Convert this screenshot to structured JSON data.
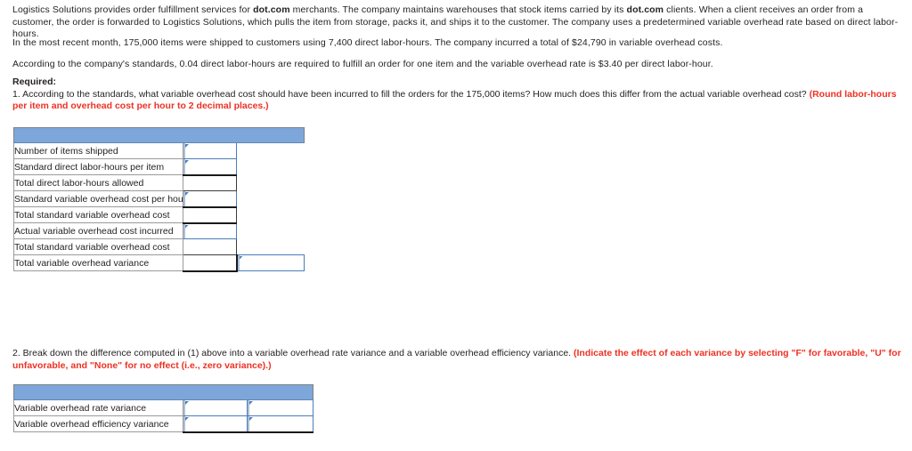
{
  "problem": {
    "paragraph_1_part_1": "Logistics Solutions provides order fulfillment services for ",
    "paragraph_1_bold_1": "dot.com",
    "paragraph_1_part_2": " merchants. The company maintains warehouses that stock items carried by its ",
    "paragraph_1_bold_2": "dot.com",
    "paragraph_1_part_3": " clients. When a client receives an order from a customer, the order is forwarded to Logistics Solutions, which pulls the item from storage, packs it, and ships it to the customer. The company uses a predetermined variable overhead rate based on direct labor-hours.",
    "paragraph_2": "In the most recent month, 175,000 items were shipped to customers using 7,400 direct labor-hours. The company incurred a total of $24,790 in variable overhead costs.",
    "paragraph_3": "According to the company's standards, 0.04 direct labor-hours are required to fulfill an order for one item and the variable overhead rate is $3.40 per direct labor-hour."
  },
  "required": {
    "title": "Required:",
    "question_1_text": "1. According to the standards, what variable overhead cost should have been incurred to fill the orders for the 175,000 items? How much does this differ from the actual variable overhead cost? ",
    "question_1_note": "(Round labor-hours per item and overhead cost per hour to 2 decimal places.)"
  },
  "question_2": {
    "text": "2. Break down the difference computed in (1) above into a variable overhead rate variance and a variable overhead efficiency variance. ",
    "note": "(Indicate the effect of each variance by selecting \"F\" for favorable, \"U\" for unfavorable, and \"None\" for no effect (i.e., zero variance).)"
  },
  "table1": {
    "header_label": "",
    "rows": [
      {
        "label": "Number of items shipped",
        "col2": "input",
        "col3": "empty",
        "value2": "",
        "value3": ""
      },
      {
        "label": "Standard direct labor-hours per item",
        "col2": "input",
        "col3": "empty",
        "value2": "",
        "value3": ""
      },
      {
        "label": "Total direct labor-hours allowed",
        "col2": "blank",
        "col3": "empty",
        "value2": "",
        "value3": ""
      },
      {
        "label": "Standard variable overhead cost per hour",
        "col2": "input",
        "col3": "empty",
        "value2": "",
        "value3": ""
      },
      {
        "label": "Total standard variable overhead cost",
        "col2": "blank",
        "col3": "empty",
        "value2": "",
        "value3": ""
      },
      {
        "label": "Actual variable overhead cost incurred",
        "col2": "input",
        "col3": "empty",
        "value2": "",
        "value3": ""
      },
      {
        "label": "Total standard variable overhead cost",
        "col2": "blank",
        "col3": "empty",
        "value2": "",
        "value3": ""
      },
      {
        "label": "Total variable overhead variance",
        "col2": "blank",
        "col3": "input",
        "value2": "",
        "value3": ""
      }
    ]
  },
  "table2": {
    "header_label": "",
    "rows": [
      {
        "label": "Variable overhead rate variance",
        "col2": "input",
        "col3": "input",
        "value2": "",
        "value3": ""
      },
      {
        "label": "Variable overhead efficiency variance",
        "col2": "input",
        "col3": "input",
        "value2": "",
        "value3": ""
      }
    ]
  },
  "colors": {
    "header_blue": "#7da7db",
    "input_border_blue": "#4a7ebb",
    "note_red": "#ee3124"
  }
}
